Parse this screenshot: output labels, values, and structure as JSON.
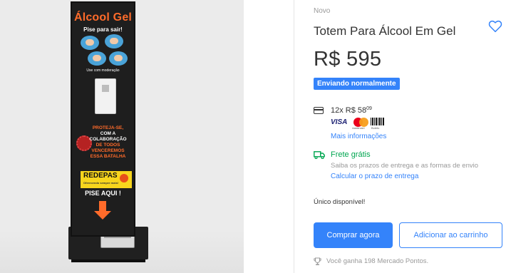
{
  "gallery": {
    "product_image": {
      "title": "Álcool Gel",
      "subtitle": "Pise para sair!",
      "moderation": "Use com moderação",
      "message_lines": [
        "PROTEJA-SE,",
        "COM A COLABORAÇÃO",
        "DE TODOS",
        "VENCEREMOS",
        "ESSA BATALHA"
      ],
      "brand": "REDEPAS",
      "brand_sub": "Oferecendo sempre mais!",
      "cta": "PISE AQUI !",
      "accent_color": "#ff6b2a"
    }
  },
  "product": {
    "condition": "Novo",
    "title": "Totem Para Álcool Em Gel",
    "favorite_icon": "heart-outline-icon",
    "price": "R$ 595",
    "shipping_badge": "Enviando normalmente"
  },
  "payment": {
    "icon": "credit-card-icon",
    "installments": "12x R$ 58",
    "installments_cents": "09",
    "brands": {
      "visa": "VISA",
      "mastercard": "mastercard",
      "boleto": "Boleto"
    },
    "more_info_link": "Mais informações"
  },
  "shipping": {
    "icon": "truck-icon",
    "title": "Frete grátis",
    "description": "Saiba os prazos de entrega e as formas de envio",
    "calc_link": "Calcular o prazo de entrega"
  },
  "stock": {
    "text": "Único disponível!"
  },
  "actions": {
    "buy_now": "Comprar agora",
    "add_to_cart": "Adicionar ao carrinho"
  },
  "loyalty": {
    "icon": "trophy-icon",
    "text": "Você ganha 198 Mercado Pontos."
  },
  "colors": {
    "primary": "#3483fa",
    "success": "#00a650",
    "muted": "#999999",
    "text": "#333333"
  }
}
